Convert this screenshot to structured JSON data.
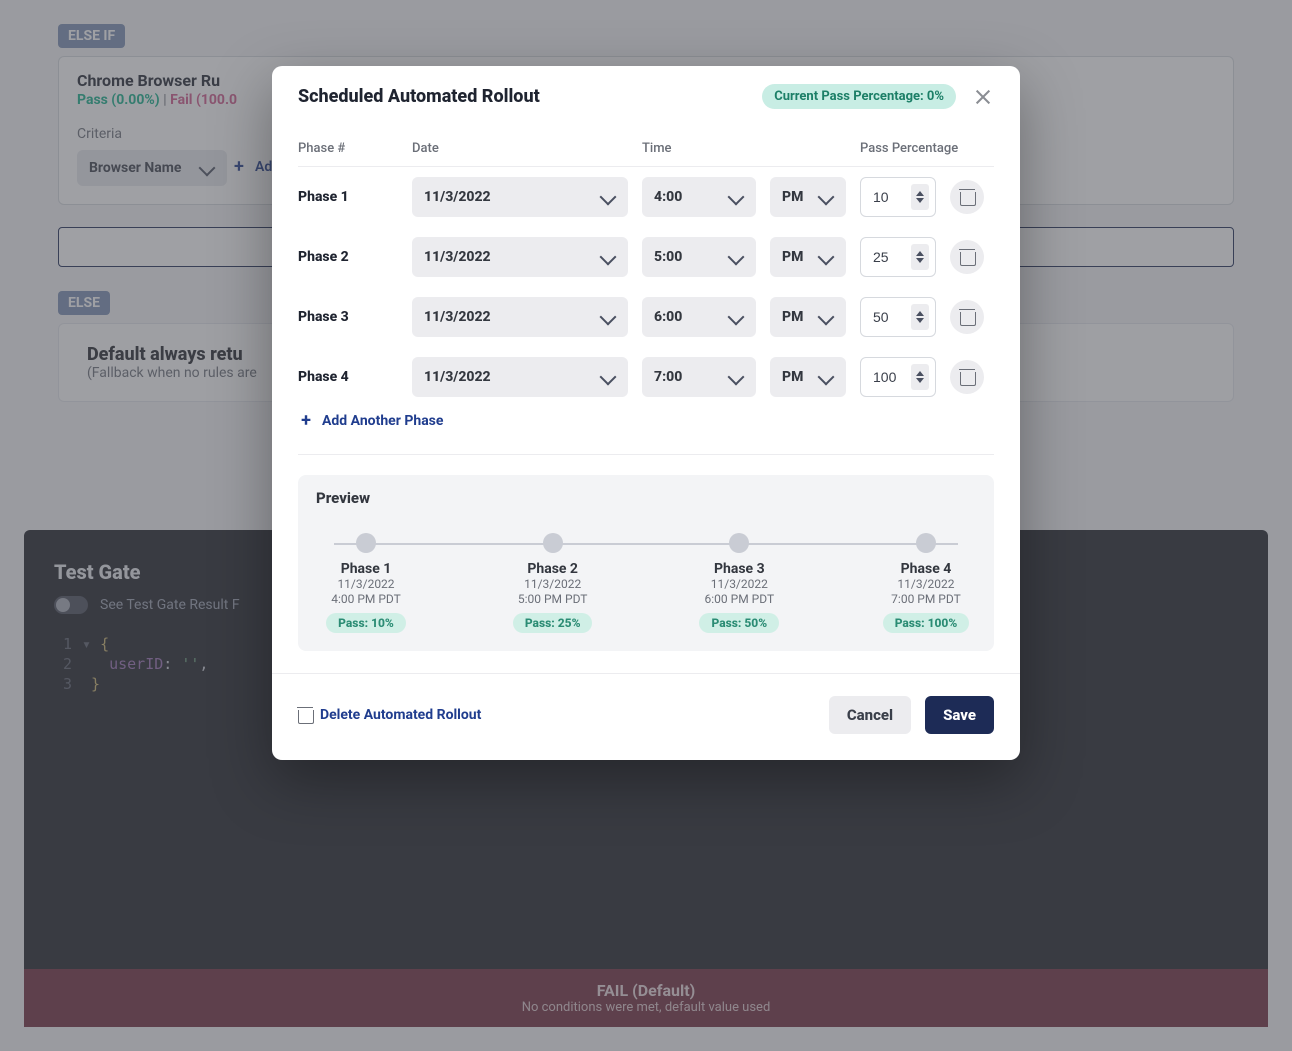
{
  "bg": {
    "else_if_label": "ELSE IF",
    "rule_title": "Chrome Browser Ru",
    "pass_text": "Pass (0.00%)",
    "sep": "|",
    "fail_text": "Fail (100.0",
    "criteria_label": "Criteria",
    "criteria_select": "Browser Name",
    "add_conditions": "Add more conditions",
    "else_label": "ELSE",
    "default_title": "Default always retu",
    "default_sub": "(Fallback when no rules are",
    "test_title": "Test Gate",
    "test_toggle_label": "See Test Gate Result F",
    "code_line_1": "{",
    "code_line_2_key": "userID",
    "code_line_2_val": "''",
    "code_line_3": "}",
    "fail_bar_head": "FAIL (Default)",
    "fail_bar_sub": "No conditions were met, default value used"
  },
  "modal": {
    "title": "Scheduled Automated Rollout",
    "pass_pill": "Current Pass Percentage: 0%",
    "columns": {
      "phase": "Phase #",
      "date": "Date",
      "time": "Time",
      "pct": "Pass Percentage"
    },
    "phases": [
      {
        "label": "Phase 1",
        "date": "11/3/2022",
        "time": "4:00",
        "ampm": "PM",
        "pct": "10"
      },
      {
        "label": "Phase 2",
        "date": "11/3/2022",
        "time": "5:00",
        "ampm": "PM",
        "pct": "25"
      },
      {
        "label": "Phase 3",
        "date": "11/3/2022",
        "time": "6:00",
        "ampm": "PM",
        "pct": "50"
      },
      {
        "label": "Phase 4",
        "date": "11/3/2022",
        "time": "7:00",
        "ampm": "PM",
        "pct": "100"
      }
    ],
    "add_phase": "Add Another Phase",
    "preview_title": "Preview",
    "preview_steps": [
      {
        "title": "Phase 1",
        "date": "11/3/2022",
        "when": "4:00 PM PDT",
        "pill": "Pass: 10%"
      },
      {
        "title": "Phase 2",
        "date": "11/3/2022",
        "when": "5:00 PM PDT",
        "pill": "Pass: 25%"
      },
      {
        "title": "Phase 3",
        "date": "11/3/2022",
        "when": "6:00 PM PDT",
        "pill": "Pass: 50%"
      },
      {
        "title": "Phase 4",
        "date": "11/3/2022",
        "when": "7:00 PM PDT",
        "pill": "Pass: 100%"
      }
    ],
    "delete_label": "Delete Automated Rollout",
    "cancel": "Cancel",
    "save": "Save"
  }
}
